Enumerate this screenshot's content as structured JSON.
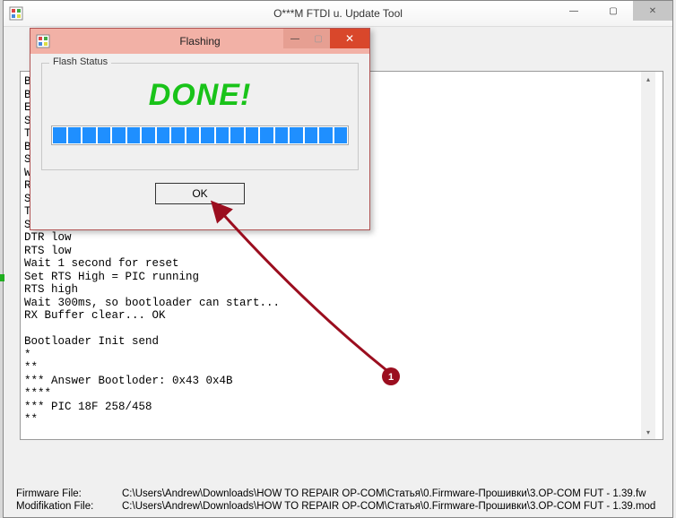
{
  "main_window": {
    "title": "O***M FTDI u. Update Tool",
    "controls": {
      "min": "—",
      "max": "▢",
      "close": "✕"
    },
    "menubar": [
      "",
      "",
      ""
    ]
  },
  "log_text": "B\nB\nE\nS\nT\nB\nS\nW\nR\nS\nTimeout 5 seconds\nSet DTR and RTS Low = PIC Reset\nDTR low\nRTS low\nWait 1 second for reset\nSet RTS High = PIC running\nRTS high\nWait 300ms, so bootloader can start...\nRX Buffer clear... OK\n\nBootloader Init send\n*\n**\n*** Answer Bootloder: 0x43 0x4B\n****\n*** PIC 18F 258/458\n**",
  "footer": {
    "firmware_label": "Firmware File:",
    "firmware_path": "C:\\Users\\Andrew\\Downloads\\HOW TO REPAIR OP-COM\\Статья\\0.Firmware-Прошивки\\3.OP-COM FUT - 1.39.fw",
    "mod_label": "Modifikation File:",
    "mod_path": "C:\\Users\\Andrew\\Downloads\\HOW TO REPAIR OP-COM\\Статья\\0.Firmware-Прошивки\\3.OP-COM FUT - 1.39.mod"
  },
  "dialog": {
    "title": "Flashing",
    "controls": {
      "min": "—",
      "max": "▢",
      "close": "✕"
    },
    "group_label": "Flash Status",
    "status_text": "DONE!",
    "progress_blocks": 20,
    "ok_label": "OK"
  },
  "annotation": {
    "badge": "1"
  }
}
